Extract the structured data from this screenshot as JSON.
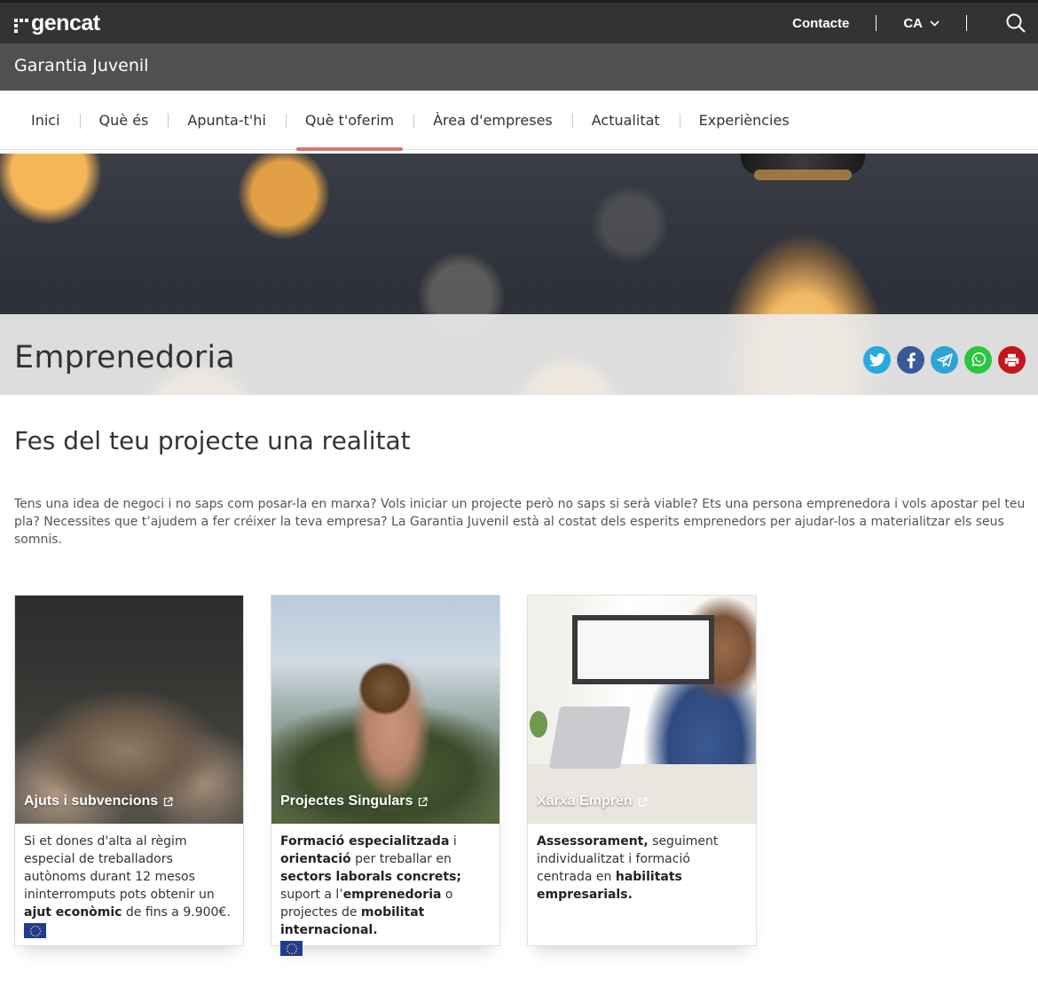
{
  "topbar": {
    "logo_text": "gencat",
    "contact_label": "Contacte",
    "language": "CA"
  },
  "site": {
    "title": "Garantia Juvenil"
  },
  "nav": {
    "items": [
      {
        "label": "Inici"
      },
      {
        "label": "Què és"
      },
      {
        "label": "Apunta-t'hi"
      },
      {
        "label": "Què t'oferim"
      },
      {
        "label": "Àrea d'empreses"
      },
      {
        "label": "Actualitat"
      },
      {
        "label": "Experiències"
      }
    ],
    "active": "Què t'oferim"
  },
  "hero": {
    "title": "Emprenedoria"
  },
  "share": {
    "twitter_color": "#29a9e1",
    "facebook_color": "#3b5998",
    "telegram_color": "#2ca3d9",
    "whatsapp_color": "#27c73f",
    "print_color": "#c4161c"
  },
  "content": {
    "heading": "Fes del teu projecte una realitat",
    "intro": "Tens una idea de negoci i no saps com posar-la en marxa? Vols iniciar un projecte però no saps si serà viable? Ets una persona emprenedora i vols apostar pel teu pla? Necessites que t’ajudem a fer créixer la teva empresa? La Garantia Juvenil està al costat dels esperits emprenedors per ajudar-los a materialitzar els seus somnis."
  },
  "cards": [
    {
      "title": "Ajuts i subvencions",
      "t1": "Si et dones d'alta al règim especial de treballadors autònoms durant 12 mesos ininterromputs pots obtenir un ",
      "b1": "ajut econòmic",
      "t2": " de fins a 9.900€."
    },
    {
      "title": "Projectes Singulars",
      "b1": "Formació especialitzada",
      "t1": " i ",
      "b2": "orientació",
      "t2": " per treballar en ",
      "b3": "sectors laborals concrets;",
      "t3": " suport a l’",
      "b4": "emprenedoria",
      "t4": " o projectes de ",
      "b5": "mobilitat internacional."
    },
    {
      "title": "Xarxa Emprèn",
      "b1": "Assessorament,",
      "t1": " seguiment individualitzat i formació centrada en ",
      "b2": "habilitats empresarials."
    }
  ]
}
